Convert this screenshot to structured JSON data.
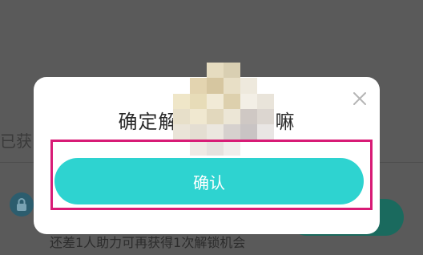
{
  "background": {
    "side_label": "已获",
    "tip_text": "还差1人助力可再获得1次解锁机会"
  },
  "dialog": {
    "title_prefix": "确定解",
    "title_suffix": "夸嘛",
    "confirm_label": "确认",
    "close_icon": "close-icon",
    "colors": {
      "confirm": "#2ed3d0",
      "highlight": "#d81b76"
    }
  }
}
